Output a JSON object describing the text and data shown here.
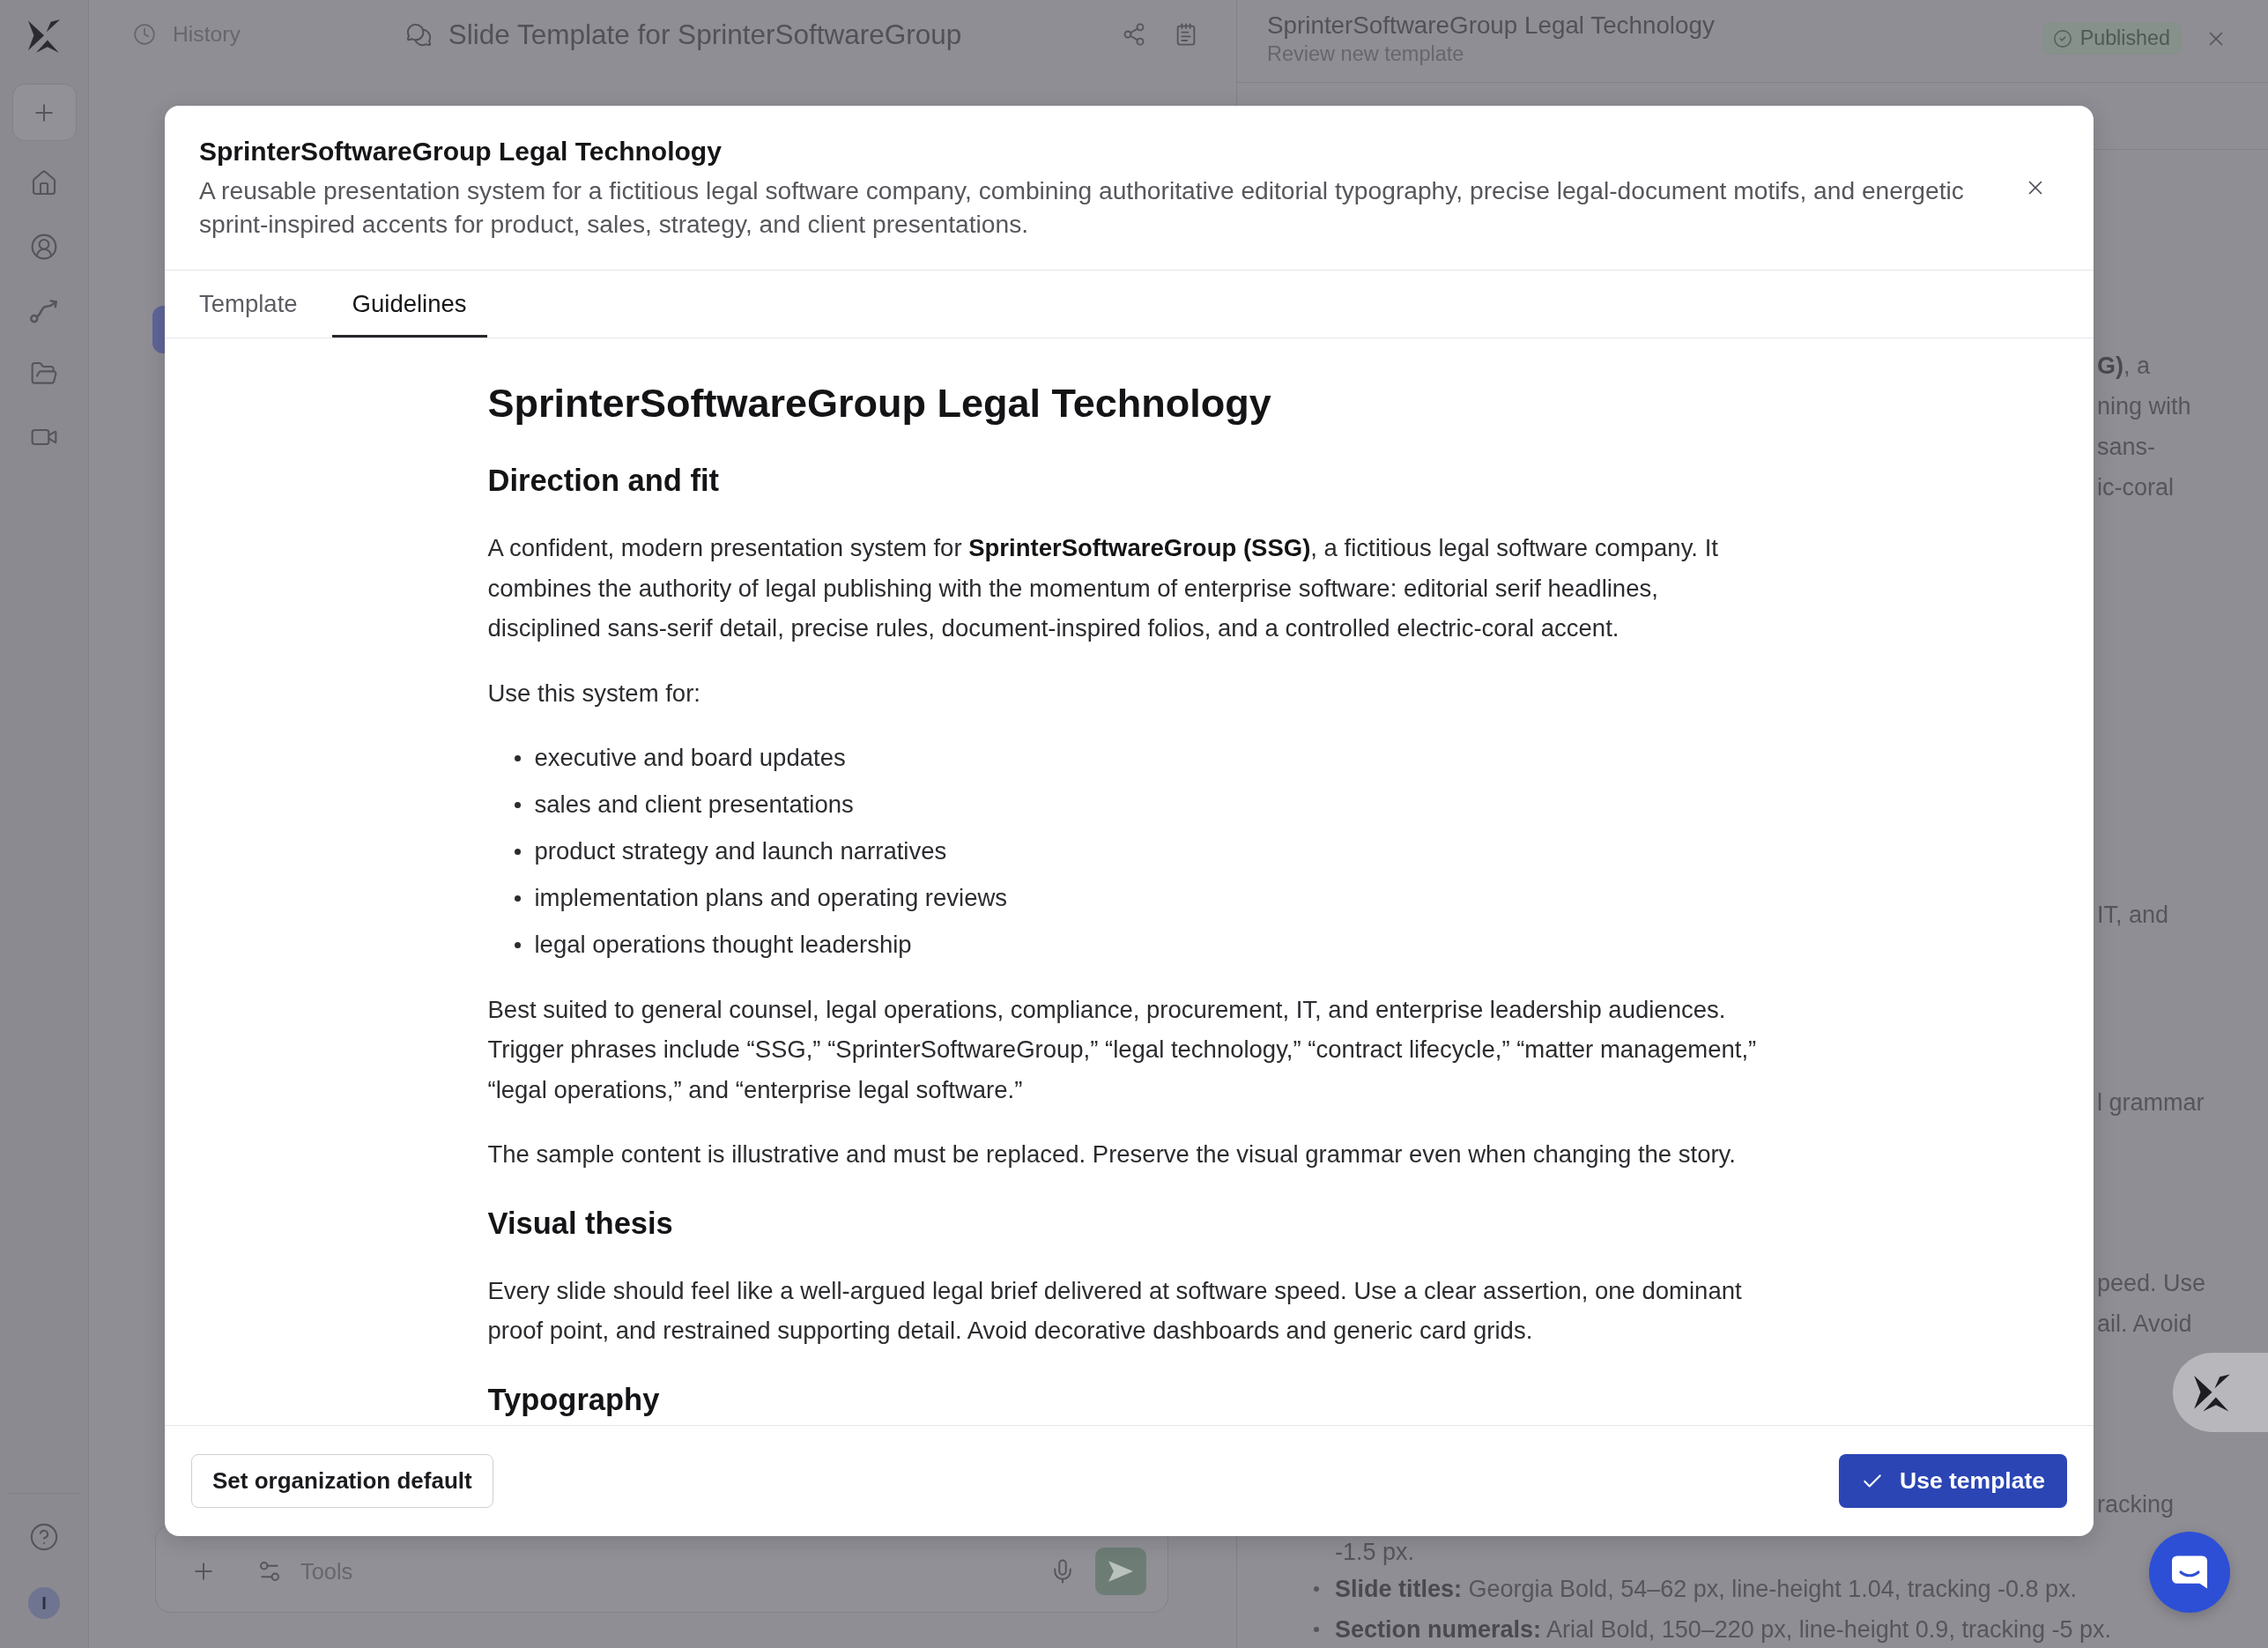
{
  "sidebar": {
    "avatar_initial": "I"
  },
  "top_bar": {
    "history_label": "History",
    "title": "Slide Template for SprinterSoftwareGroup"
  },
  "composer": {
    "tools_label": "Tools"
  },
  "review_panel": {
    "title": "SprinterSoftwareGroup Legal Technology",
    "subtitle": "Review new template",
    "status": "Published",
    "fragments": [
      {
        "lines": [
          "**G)**, a",
          "ning with",
          "sans-",
          "ic-coral"
        ]
      },
      {
        "lines": [
          "IT, and"
        ]
      },
      {
        "lines": [
          "l grammar"
        ]
      },
      {
        "lines": [
          "peed. Use",
          "ail. Avoid"
        ]
      },
      {
        "lines": [
          "racking"
        ]
      }
    ],
    "list_continuation": "-1.5 px.",
    "list_items": [
      "**Slide titles:** Georgia Bold, 54–62 px, line-height 1.04, tracking -0.8 px.",
      "**Section numerals:** Arial Bold, 150–220 px, line-height 0.9, tracking -5 px."
    ]
  },
  "modal": {
    "title": "SprinterSoftwareGroup Legal Technology",
    "description": "A reusable presentation system for a fictitious legal software company, combining authoritative editorial typography, precise legal-document motifs, and energetic sprint-inspired accents for product, sales, strategy, and client presentations.",
    "tabs": [
      {
        "label": "Template",
        "selected": false
      },
      {
        "label": "Guidelines",
        "selected": true
      }
    ],
    "content": [
      {
        "kind": "title",
        "text": "SprinterSoftwareGroup Legal Technology"
      },
      {
        "kind": "heading",
        "text": "Direction and fit"
      },
      {
        "kind": "paragraph",
        "text": "A confident, modern presentation system for **SprinterSoftwareGroup (SSG)**, a fictitious legal software company. It combines the authority of legal publishing with the momentum of enterprise software: editorial serif headlines, disciplined sans-serif detail, precise rules, document-inspired folios, and a controlled electric-coral accent."
      },
      {
        "kind": "paragraph",
        "text": "Use this system for:"
      },
      {
        "kind": "list",
        "items": [
          "executive and board updates",
          "sales and client presentations",
          "product strategy and launch narratives",
          "implementation plans and operating reviews",
          "legal operations thought leadership"
        ]
      },
      {
        "kind": "paragraph",
        "text": "Best suited to general counsel, legal operations, compliance, procurement, IT, and enterprise leadership audiences. Trigger phrases include “SSG,” “SprinterSoftwareGroup,” “legal technology,” “contract lifecycle,” “matter management,” “legal operations,” and “enterprise legal software.”"
      },
      {
        "kind": "paragraph",
        "text": "The sample content is illustrative and must be replaced. Preserve the visual grammar even when changing the story."
      },
      {
        "kind": "heading",
        "text": "Visual thesis"
      },
      {
        "kind": "paragraph",
        "text": "Every slide should feel like a well-argued legal brief delivered at software speed. Use a clear assertion, one dominant proof point, and restrained supporting detail. Avoid decorative dashboards and generic card grids."
      },
      {
        "kind": "heading",
        "text": "Typography"
      }
    ],
    "secondary_button": "Set organization default",
    "primary_button": "Use template"
  }
}
